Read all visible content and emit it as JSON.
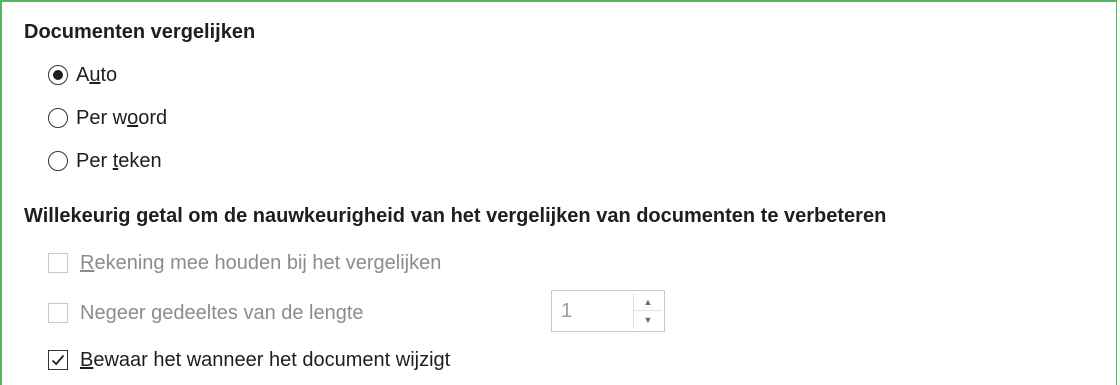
{
  "compare": {
    "title": "Documenten vergelijken",
    "options": [
      {
        "pre": "A",
        "mn": "u",
        "post": "to",
        "selected": true
      },
      {
        "pre": "Per w",
        "mn": "o",
        "post": "ord",
        "selected": false
      },
      {
        "pre": "Per ",
        "mn": "t",
        "post": "eken",
        "selected": false
      }
    ]
  },
  "random": {
    "title": "Willekeurig getal om de nauwkeurigheid van het vergelijken van documenten te verbeteren",
    "take_into_account": {
      "mn": "R",
      "rest": "ekening mee houden bij het vergelijken",
      "checked": false,
      "enabled": false
    },
    "ignore": {
      "text": "Negeer gedeeltes van de lengte",
      "checked": false,
      "enabled": false
    },
    "ignore_length_value": "1",
    "store": {
      "mn": "B",
      "rest": "ewaar het wanneer het document wijzigt",
      "checked": true,
      "enabled": true
    }
  },
  "icons": {
    "spin_up": "spin-up-icon",
    "spin_down": "spin-down-icon",
    "check": "checkmark-icon"
  }
}
